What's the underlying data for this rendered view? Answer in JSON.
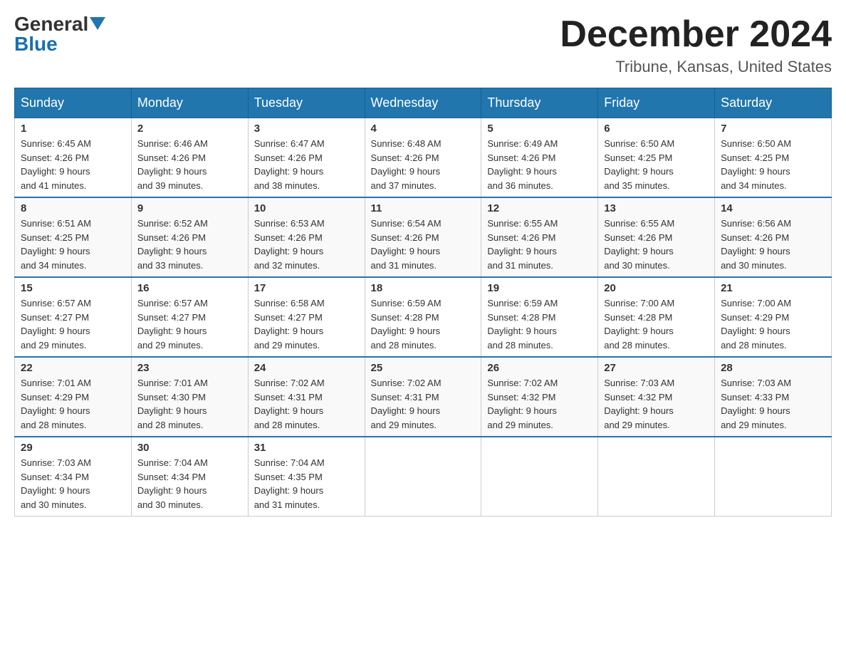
{
  "logo": {
    "general": "General",
    "blue": "Blue"
  },
  "title": {
    "month_year": "December 2024",
    "location": "Tribune, Kansas, United States"
  },
  "weekdays": [
    "Sunday",
    "Monday",
    "Tuesday",
    "Wednesday",
    "Thursday",
    "Friday",
    "Saturday"
  ],
  "weeks": [
    [
      {
        "day": "1",
        "sunrise": "6:45 AM",
        "sunset": "4:26 PM",
        "daylight": "9 hours and 41 minutes."
      },
      {
        "day": "2",
        "sunrise": "6:46 AM",
        "sunset": "4:26 PM",
        "daylight": "9 hours and 39 minutes."
      },
      {
        "day": "3",
        "sunrise": "6:47 AM",
        "sunset": "4:26 PM",
        "daylight": "9 hours and 38 minutes."
      },
      {
        "day": "4",
        "sunrise": "6:48 AM",
        "sunset": "4:26 PM",
        "daylight": "9 hours and 37 minutes."
      },
      {
        "day": "5",
        "sunrise": "6:49 AM",
        "sunset": "4:26 PM",
        "daylight": "9 hours and 36 minutes."
      },
      {
        "day": "6",
        "sunrise": "6:50 AM",
        "sunset": "4:25 PM",
        "daylight": "9 hours and 35 minutes."
      },
      {
        "day": "7",
        "sunrise": "6:50 AM",
        "sunset": "4:25 PM",
        "daylight": "9 hours and 34 minutes."
      }
    ],
    [
      {
        "day": "8",
        "sunrise": "6:51 AM",
        "sunset": "4:25 PM",
        "daylight": "9 hours and 34 minutes."
      },
      {
        "day": "9",
        "sunrise": "6:52 AM",
        "sunset": "4:26 PM",
        "daylight": "9 hours and 33 minutes."
      },
      {
        "day": "10",
        "sunrise": "6:53 AM",
        "sunset": "4:26 PM",
        "daylight": "9 hours and 32 minutes."
      },
      {
        "day": "11",
        "sunrise": "6:54 AM",
        "sunset": "4:26 PM",
        "daylight": "9 hours and 31 minutes."
      },
      {
        "day": "12",
        "sunrise": "6:55 AM",
        "sunset": "4:26 PM",
        "daylight": "9 hours and 31 minutes."
      },
      {
        "day": "13",
        "sunrise": "6:55 AM",
        "sunset": "4:26 PM",
        "daylight": "9 hours and 30 minutes."
      },
      {
        "day": "14",
        "sunrise": "6:56 AM",
        "sunset": "4:26 PM",
        "daylight": "9 hours and 30 minutes."
      }
    ],
    [
      {
        "day": "15",
        "sunrise": "6:57 AM",
        "sunset": "4:27 PM",
        "daylight": "9 hours and 29 minutes."
      },
      {
        "day": "16",
        "sunrise": "6:57 AM",
        "sunset": "4:27 PM",
        "daylight": "9 hours and 29 minutes."
      },
      {
        "day": "17",
        "sunrise": "6:58 AM",
        "sunset": "4:27 PM",
        "daylight": "9 hours and 29 minutes."
      },
      {
        "day": "18",
        "sunrise": "6:59 AM",
        "sunset": "4:28 PM",
        "daylight": "9 hours and 28 minutes."
      },
      {
        "day": "19",
        "sunrise": "6:59 AM",
        "sunset": "4:28 PM",
        "daylight": "9 hours and 28 minutes."
      },
      {
        "day": "20",
        "sunrise": "7:00 AM",
        "sunset": "4:28 PM",
        "daylight": "9 hours and 28 minutes."
      },
      {
        "day": "21",
        "sunrise": "7:00 AM",
        "sunset": "4:29 PM",
        "daylight": "9 hours and 28 minutes."
      }
    ],
    [
      {
        "day": "22",
        "sunrise": "7:01 AM",
        "sunset": "4:29 PM",
        "daylight": "9 hours and 28 minutes."
      },
      {
        "day": "23",
        "sunrise": "7:01 AM",
        "sunset": "4:30 PM",
        "daylight": "9 hours and 28 minutes."
      },
      {
        "day": "24",
        "sunrise": "7:02 AM",
        "sunset": "4:31 PM",
        "daylight": "9 hours and 28 minutes."
      },
      {
        "day": "25",
        "sunrise": "7:02 AM",
        "sunset": "4:31 PM",
        "daylight": "9 hours and 29 minutes."
      },
      {
        "day": "26",
        "sunrise": "7:02 AM",
        "sunset": "4:32 PM",
        "daylight": "9 hours and 29 minutes."
      },
      {
        "day": "27",
        "sunrise": "7:03 AM",
        "sunset": "4:32 PM",
        "daylight": "9 hours and 29 minutes."
      },
      {
        "day": "28",
        "sunrise": "7:03 AM",
        "sunset": "4:33 PM",
        "daylight": "9 hours and 29 minutes."
      }
    ],
    [
      {
        "day": "29",
        "sunrise": "7:03 AM",
        "sunset": "4:34 PM",
        "daylight": "9 hours and 30 minutes."
      },
      {
        "day": "30",
        "sunrise": "7:04 AM",
        "sunset": "4:34 PM",
        "daylight": "9 hours and 30 minutes."
      },
      {
        "day": "31",
        "sunrise": "7:04 AM",
        "sunset": "4:35 PM",
        "daylight": "9 hours and 31 minutes."
      },
      null,
      null,
      null,
      null
    ]
  ],
  "labels": {
    "sunrise": "Sunrise:",
    "sunset": "Sunset:",
    "daylight": "Daylight:"
  }
}
